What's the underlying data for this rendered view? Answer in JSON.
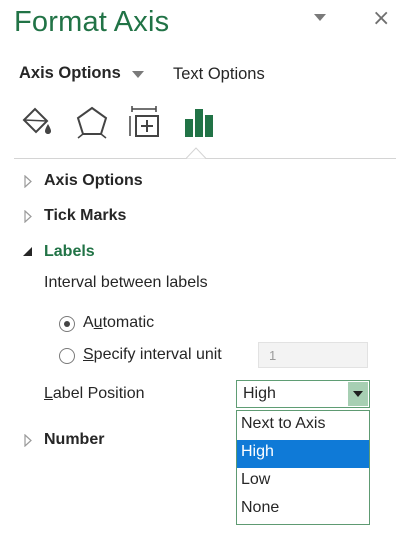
{
  "colors": {
    "background": "#ffffff",
    "accent_green": "#217346",
    "selection_blue": "#0f7ad7"
  },
  "header": {
    "title": "Format Axis",
    "close_glyph": "×"
  },
  "tabs": {
    "axis_options": "Axis Options",
    "text_options": "Text Options"
  },
  "icons": [
    "fill-line-icon",
    "effects-pentagon-icon",
    "size-properties-icon",
    "axis-options-bar-chart-icon"
  ],
  "sections": {
    "axis_options": "Axis Options",
    "tick_marks": "Tick Marks",
    "labels": "Labels",
    "number": "Number"
  },
  "labels": {
    "interval_caption": "Interval between labels",
    "automatic": {
      "pre": "A",
      "ul": "u",
      "post": "tomatic",
      "selected": true
    },
    "specify": {
      "pre": "",
      "ul": "S",
      "post": "pecify interval unit",
      "selected": false
    },
    "interval_value": "1",
    "label_position": {
      "pre": "",
      "ul": "L",
      "post": "abel Position"
    },
    "position_value": "High",
    "position_options": [
      "Next to Axis",
      "High",
      "Low",
      "None"
    ],
    "position_selected_index": 1
  }
}
